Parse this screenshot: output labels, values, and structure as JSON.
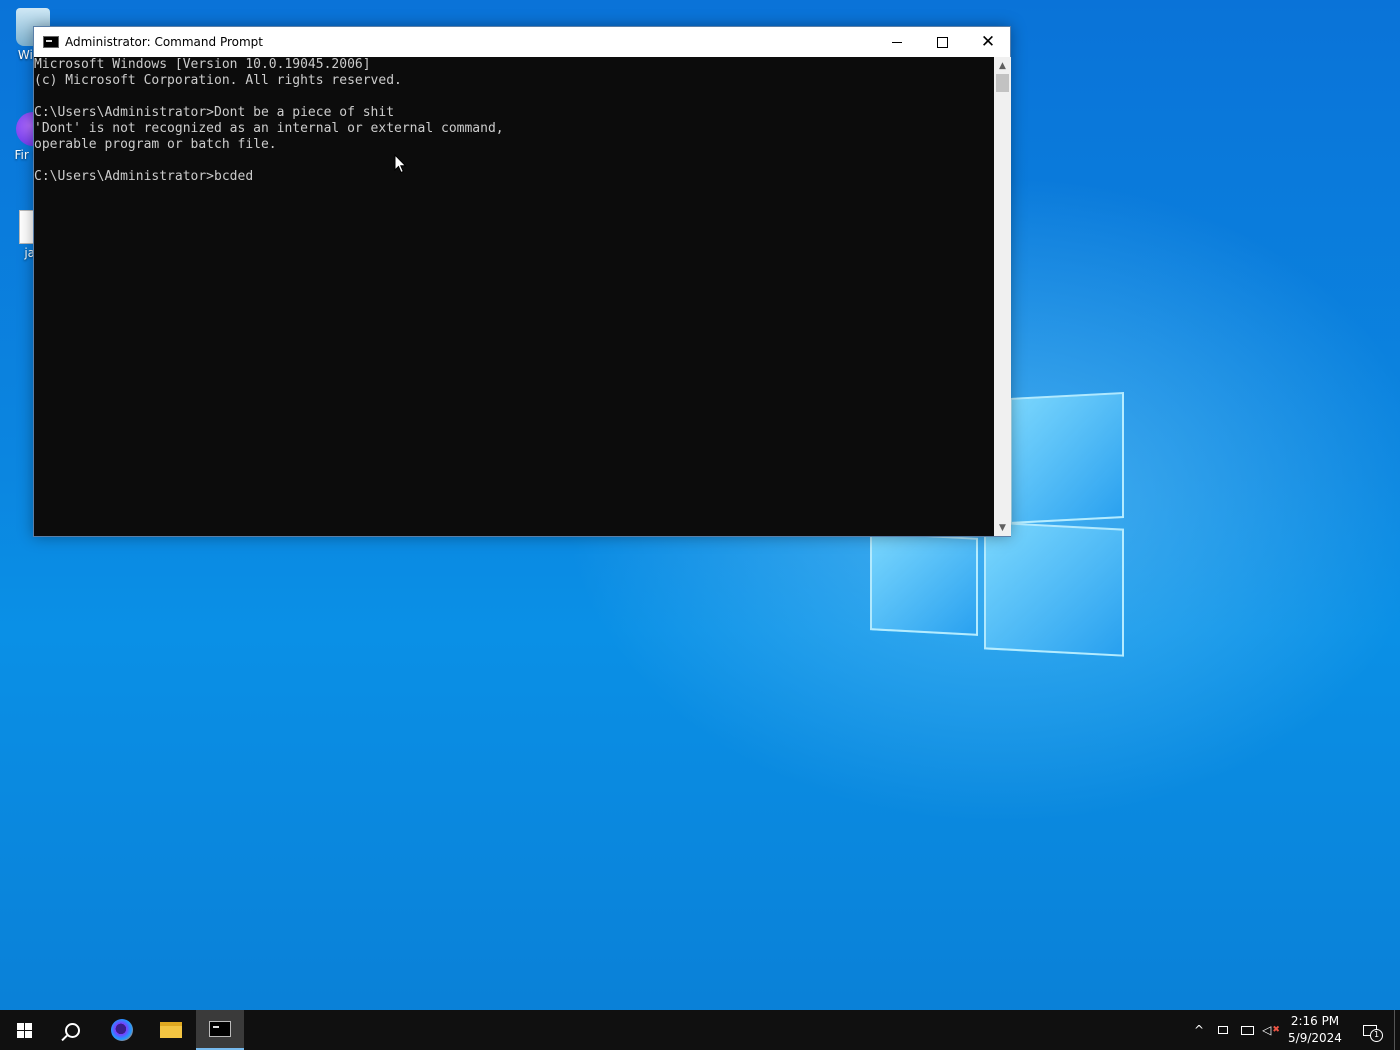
{
  "desktop": {
    "icons": [
      {
        "label": "Wind"
      },
      {
        "label": "Fir Nic"
      },
      {
        "label": "jac"
      }
    ]
  },
  "window": {
    "title": "Administrator: Command Prompt",
    "close_glyph": "✕"
  },
  "console": {
    "lines": [
      "Microsoft Windows [Version 10.0.19045.2006]",
      "(c) Microsoft Corporation. All rights reserved.",
      "",
      "C:\\Users\\Administrator>Dont be a piece of shit",
      "'Dont' is not recognized as an internal or external command,",
      "operable program or batch file.",
      "",
      "C:\\Users\\Administrator>bcded"
    ]
  },
  "scrollbar": {
    "up_glyph": "▲",
    "down_glyph": "▼"
  },
  "taskbar": {
    "clock": {
      "time": "2:16 PM",
      "date": "5/9/2024"
    },
    "tray": {
      "chevron_glyph": "^",
      "notification_count": "1"
    }
  }
}
